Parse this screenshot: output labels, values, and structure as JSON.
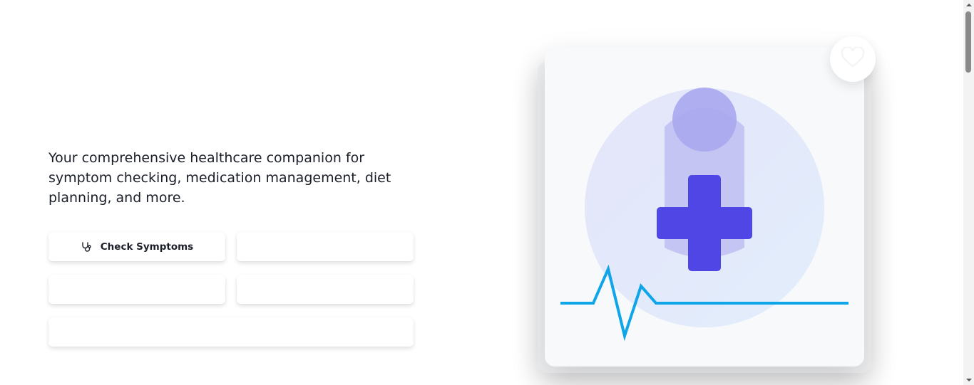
{
  "hero": {
    "description": "Your comprehensive healthcare companion for symptom checking, medication management, diet planning, and more."
  },
  "actions": [
    {
      "label": "Check Symptoms",
      "icon": "stethoscope-icon"
    },
    {
      "label": ""
    },
    {
      "label": ""
    },
    {
      "label": ""
    },
    {
      "label": ""
    }
  ],
  "illustration": {
    "icons": [
      "medical-cross-icon",
      "heartbeat-line-icon",
      "heart-icon"
    ],
    "colors": {
      "cross": "#4f46e5",
      "pulse": "#0ea5e9",
      "circle": "#e6e8fb",
      "figure": "#a5a6f0"
    }
  }
}
